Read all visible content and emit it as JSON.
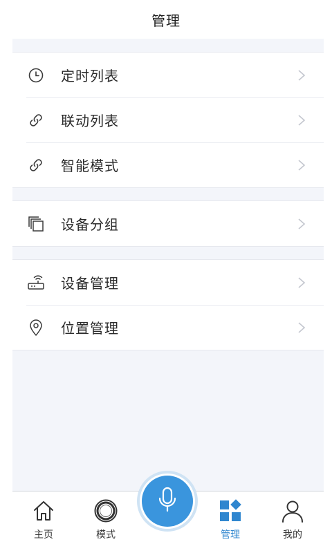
{
  "header": {
    "title": "管理"
  },
  "groups": [
    {
      "items": [
        {
          "label": "定时列表",
          "icon": "clock-icon"
        },
        {
          "label": "联动列表",
          "icon": "link-icon"
        },
        {
          "label": "智能模式",
          "icon": "link-icon"
        }
      ]
    },
    {
      "items": [
        {
          "label": "设备分组",
          "icon": "stack-icon"
        }
      ]
    },
    {
      "items": [
        {
          "label": "设备管理",
          "icon": "router-icon"
        },
        {
          "label": "位置管理",
          "icon": "location-pin-icon"
        }
      ]
    }
  ],
  "tabbar": {
    "tabs": [
      {
        "label": "主页",
        "icon": "home-icon",
        "active": false
      },
      {
        "label": "模式",
        "icon": "ring-icon",
        "active": false
      },
      {
        "label": "管理",
        "icon": "grid-icon",
        "active": true
      },
      {
        "label": "我的",
        "icon": "user-icon",
        "active": false
      }
    ],
    "center_button": {
      "icon": "microphone-icon"
    }
  },
  "colors": {
    "accent": "#3a95dd",
    "active_tab": "#2f86cf",
    "background": "#f3f5fa",
    "text": "#2a2a2a"
  }
}
